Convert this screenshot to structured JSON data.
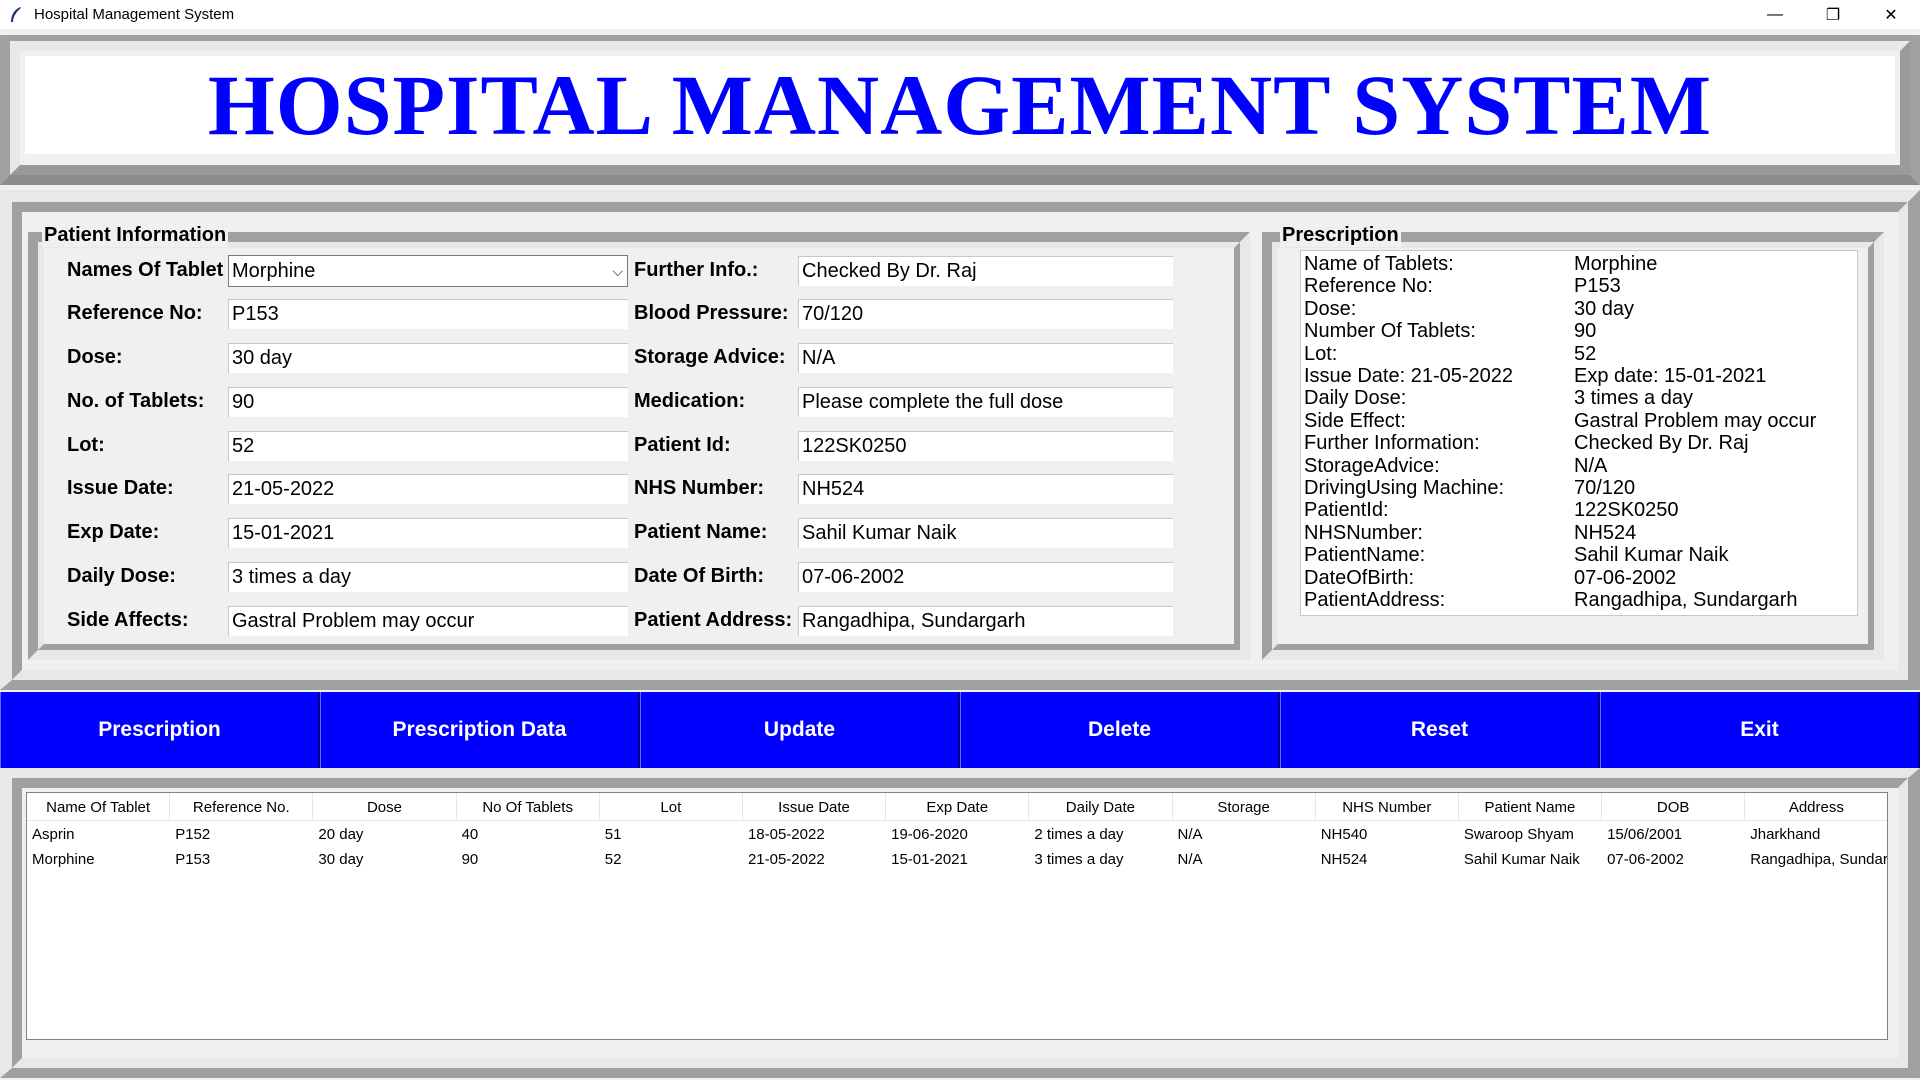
{
  "window": {
    "title": "Hospital Management System",
    "minimize": "—",
    "restore": "❐",
    "close": "✕"
  },
  "header": {
    "title": "HOSPITAL MANAGEMENT SYSTEM"
  },
  "patient_info": {
    "label": "Patient Information",
    "left": [
      {
        "label": "Names Of Tablet",
        "value": "Morphine"
      },
      {
        "label": "Reference No:",
        "value": "P153"
      },
      {
        "label": "Dose:",
        "value": "30 day"
      },
      {
        "label": "No. of Tablets:",
        "value": "90"
      },
      {
        "label": "Lot:",
        "value": "52"
      },
      {
        "label": "Issue Date:",
        "value": "21-05-2022"
      },
      {
        "label": "Exp Date:",
        "value": "15-01-2021"
      },
      {
        "label": "Daily Dose:",
        "value": "3 times a day"
      },
      {
        "label": "Side Affects:",
        "value": "Gastral Problem may occur"
      }
    ],
    "right": [
      {
        "label": "Further Info.:",
        "value": "Checked By Dr. Raj"
      },
      {
        "label": "Blood Pressure:",
        "value": "70/120"
      },
      {
        "label": "Storage Advice:",
        "value": "N/A"
      },
      {
        "label": "Medication:",
        "value": "Please complete the full dose"
      },
      {
        "label": "Patient Id:",
        "value": "122SK0250"
      },
      {
        "label": "NHS Number:",
        "value": "NH524"
      },
      {
        "label": "Patient Name:",
        "value": "Sahil Kumar Naik"
      },
      {
        "label": "Date Of Birth:",
        "value": "07-06-2002"
      },
      {
        "label": "Patient Address:",
        "value": "Rangadhipa, Sundargarh"
      }
    ]
  },
  "prescription": {
    "label": "Prescription",
    "lines": [
      {
        "k": "Name of Tablets:",
        "v": "Morphine"
      },
      {
        "k": "Reference No:",
        "v": "P153"
      },
      {
        "k": "Dose:",
        "v": "30 day"
      },
      {
        "k": "Number Of Tablets:",
        "v": "90"
      },
      {
        "k": "Lot:",
        "v": "52"
      },
      {
        "k": "Issue Date:  21-05-2022",
        "v": "Exp date:  15-01-2021"
      },
      {
        "k": "Daily Dose:",
        "v": "3 times a day"
      },
      {
        "k": "Side Effect:",
        "v": "Gastral Problem may occur"
      },
      {
        "k": "Further Information:",
        "v": "Checked By Dr. Raj"
      },
      {
        "k": "StorageAdvice:",
        "v": "N/A"
      },
      {
        "k": "DrivingUsing Machine:",
        "v": "70/120"
      },
      {
        "k": "PatientId:",
        "v": "122SK0250"
      },
      {
        "k": "NHSNumber:",
        "v": "NH524"
      },
      {
        "k": "PatientName:",
        "v": "Sahil Kumar Naik"
      },
      {
        "k": "DateOfBirth:",
        "v": "07-06-2002"
      },
      {
        "k": "PatientAddress:",
        "v": "Rangadhipa, Sundargarh"
      }
    ]
  },
  "buttons": [
    "Prescription",
    "Prescription Data",
    "Update",
    "Delete",
    "Reset",
    "Exit"
  ],
  "table": {
    "columns": [
      "Name Of Tablet",
      "Reference No.",
      "Dose",
      "No Of Tablets",
      "Lot",
      "Issue Date",
      "Exp Date",
      "Daily Date",
      "Storage",
      "NHS Number",
      "Patient Name",
      "DOB",
      "Address"
    ],
    "rows": [
      [
        "Asprin",
        "P152",
        "20 day",
        "40",
        "51",
        "18-05-2022",
        "19-06-2020",
        "2 times a day",
        "N/A",
        "NH540",
        "Swaroop Shyam",
        "15/06/2001",
        "Jharkhand"
      ],
      [
        "Morphine",
        "P153",
        "30 day",
        "90",
        "52",
        "21-05-2022",
        "15-01-2021",
        "3 times a day",
        "N/A",
        "NH524",
        "Sahil Kumar Naik",
        "07-06-2002",
        "Rangadhipa, Sundar"
      ]
    ]
  }
}
